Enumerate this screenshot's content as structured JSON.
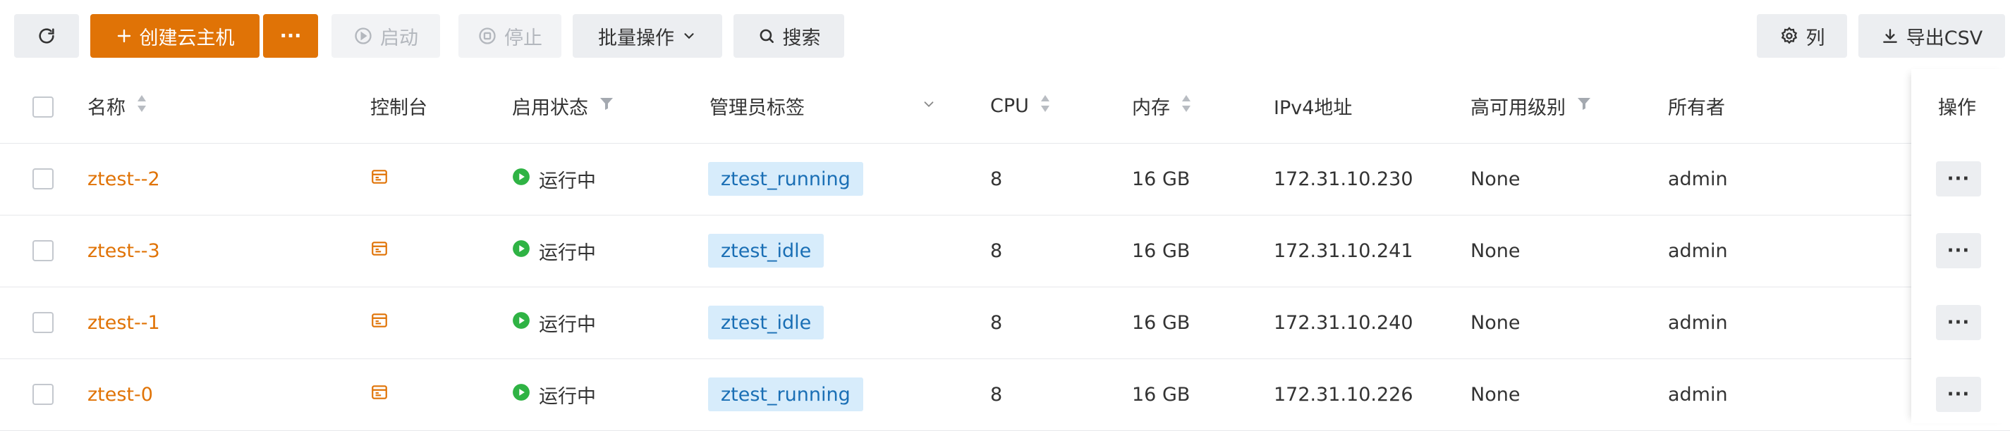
{
  "toolbar": {
    "create_label": "创建云主机",
    "more_label": "···",
    "start_label": "启动",
    "stop_label": "停止",
    "batch_label": "批量操作",
    "search_label": "搜索",
    "columns_label": "列",
    "export_label": "导出CSV"
  },
  "table": {
    "headers": {
      "name": "名称",
      "console": "控制台",
      "status": "启用状态",
      "admin_tag": "管理员标签",
      "cpu": "CPU",
      "memory": "内存",
      "ipv4": "IPv4地址",
      "ha_level": "高可用级别",
      "owner": "所有者",
      "actions": "操作"
    },
    "rows": [
      {
        "name": "ztest--2",
        "status": "运行中",
        "tag": "ztest_running",
        "cpu": "8",
        "memory": "16 GB",
        "ip": "172.31.10.230",
        "ha": "None",
        "owner": "admin",
        "more": "···"
      },
      {
        "name": "ztest--3",
        "status": "运行中",
        "tag": "ztest_idle",
        "cpu": "8",
        "memory": "16 GB",
        "ip": "172.31.10.241",
        "ha": "None",
        "owner": "admin",
        "more": "···"
      },
      {
        "name": "ztest--1",
        "status": "运行中",
        "tag": "ztest_idle",
        "cpu": "8",
        "memory": "16 GB",
        "ip": "172.31.10.240",
        "ha": "None",
        "owner": "admin",
        "more": "···"
      },
      {
        "name": "ztest-0",
        "status": "运行中",
        "tag": "ztest_running",
        "cpu": "8",
        "memory": "16 GB",
        "ip": "172.31.10.226",
        "ha": "None",
        "owner": "admin",
        "more": "···"
      }
    ]
  },
  "colors": {
    "primary": "#e07306",
    "running": "#2fb344",
    "tag_bg": "#d7ecfb",
    "tag_text": "#1a6fb5"
  },
  "icons": {
    "refresh": "refresh-icon",
    "plus": "plus-icon",
    "play": "play-circle-icon",
    "stop": "stop-circle-icon",
    "chevron": "chevron-down-icon",
    "search": "search-icon",
    "gear": "gear-icon",
    "download": "download-icon",
    "sort": "sort-icon",
    "filter": "filter-icon",
    "console": "console-icon"
  }
}
